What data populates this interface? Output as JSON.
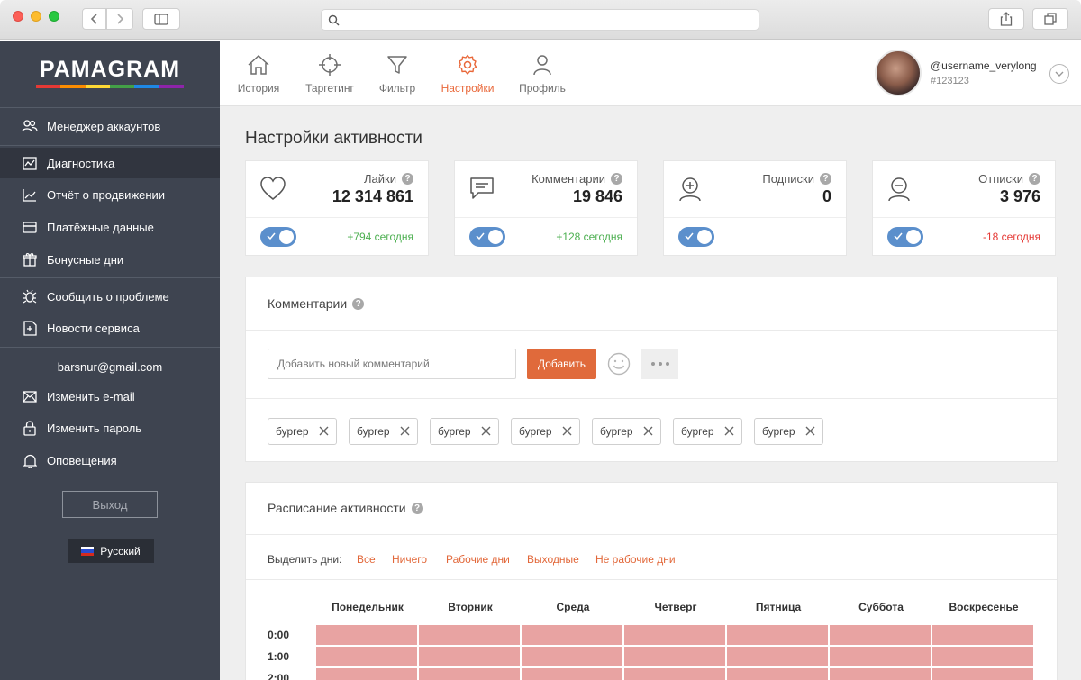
{
  "browser": {
    "address": ""
  },
  "sidebar": {
    "logo": "PAMAGRAM",
    "logo_colors": [
      "#e53935",
      "#fb8c00",
      "#fdd835",
      "#43a047",
      "#1e88e5",
      "#8e24aa"
    ],
    "items": [
      {
        "label": "Менеджер аккаунтов",
        "icon": "users-icon"
      },
      {
        "label": "Диагностика",
        "icon": "pulse-chart-icon",
        "active": true
      },
      {
        "label": "Отчёт о продвижении",
        "icon": "trend-chart-icon"
      },
      {
        "label": "Платёжные данные",
        "icon": "credit-card-icon"
      },
      {
        "label": "Бонусные дни",
        "icon": "gift-icon"
      },
      {
        "label": "Сообщить о проблеме",
        "icon": "bug-icon"
      },
      {
        "label": "Новости сервиса",
        "icon": "news-icon"
      },
      {
        "label": "Изменить e-mail",
        "icon": "envelope-icon"
      },
      {
        "label": "Изменить пароль",
        "icon": "lock-icon"
      },
      {
        "label": "Оповещения",
        "icon": "bell-icon"
      }
    ],
    "email": "barsnur@gmail.com",
    "logout": "Выход",
    "language": "Русский"
  },
  "topnav": {
    "tabs": [
      {
        "label": "История",
        "icon": "home-icon"
      },
      {
        "label": "Таргетинг",
        "icon": "crosshair-icon"
      },
      {
        "label": "Фильтр",
        "icon": "filter-icon"
      },
      {
        "label": "Настройки",
        "icon": "gear-icon",
        "active": true
      },
      {
        "label": "Профиль",
        "icon": "person-icon"
      }
    ],
    "username": "@username_verylong",
    "user_id": "#123123"
  },
  "page_title": "Настройки активности",
  "stats": [
    {
      "label": "Лайки",
      "value": "12 314 861",
      "delta": "+794 сегодня",
      "delta_color": "#4caf50",
      "enabled": true,
      "icon": "heart-icon"
    },
    {
      "label": "Комментарии",
      "value": "19 846",
      "delta": "+128 сегодня",
      "delta_color": "#4caf50",
      "enabled": true,
      "icon": "comment-icon"
    },
    {
      "label": "Подписки",
      "value": "0",
      "delta": "",
      "delta_color": "#4caf50",
      "enabled": true,
      "icon": "follow-icon"
    },
    {
      "label": "Отписки",
      "value": "3 976",
      "delta": "-18 сегодня",
      "delta_color": "#e53935",
      "enabled": true,
      "icon": "unfollow-icon"
    }
  ],
  "comments": {
    "title": "Комментарии",
    "input_placeholder": "Добавить новый комментарий",
    "add_label": "Добавить",
    "chips": [
      "бургер",
      "бургер",
      "бургер",
      "бургер",
      "бургер",
      "бургер",
      "бургер"
    ]
  },
  "schedule": {
    "title": "Расписание активности",
    "select_label": "Выделить дни:",
    "filters": [
      "Все",
      "Ничего",
      "Рабочие дни",
      "Выходные",
      "Не рабочие дни"
    ],
    "days": [
      "Понедельник",
      "Вторник",
      "Среда",
      "Четверг",
      "Пятница",
      "Суббота",
      "Воскресенье"
    ],
    "hours": [
      "0:00",
      "1:00",
      "2:00"
    ]
  }
}
